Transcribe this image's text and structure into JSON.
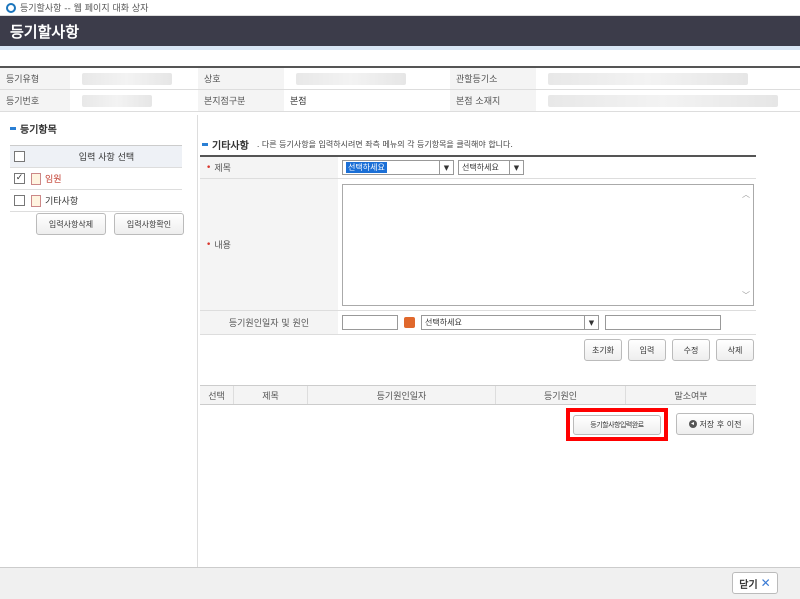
{
  "window": {
    "title": "등기할사항 -- 웹 페이지 대화 상자"
  },
  "header": {
    "title": "등기할사항"
  },
  "info": {
    "type_label": "등기유형",
    "company_label": "상호",
    "office_label": "관할등기소",
    "number_label": "등기번호",
    "branch_label": "본지점구분",
    "branch_value": "본점",
    "location_label": "본점 소재지"
  },
  "left": {
    "section_title": "등기항목",
    "select_header": "입력 사항 선택",
    "items": [
      {
        "label": "임원",
        "checked": true
      },
      {
        "label": "기타사항",
        "checked": false
      }
    ],
    "delete_button": "입력사항삭제",
    "confirm_button": "입력사항확인"
  },
  "right": {
    "section_title": "기타사항",
    "guide": ". 다른 등기사항을 입력하시려면 좌측 메뉴의 각 등기항목을 클릭해야 합니다.",
    "subject_label": "제목",
    "subject_select1": "선택하세요",
    "subject_select2": "선택하세요",
    "content_label": "내용",
    "cause_label": "등기원인일자 및 원인",
    "cause_select": "선택하세요",
    "buttons": {
      "reset": "초기화",
      "input": "입력",
      "edit": "수정",
      "delete": "삭제"
    },
    "columns": [
      "선택",
      "제목",
      "등기원인일자",
      "등기원인",
      "말소여부"
    ],
    "complete_button": "등기할사항입력완료",
    "save_prev_button": "저장 후 이전"
  },
  "footer": {
    "close_label": "닫기"
  },
  "colors": {
    "header_bg": "#3c3c4a",
    "accent": "#2a7fd4",
    "highlight_border": "#ff0000"
  }
}
